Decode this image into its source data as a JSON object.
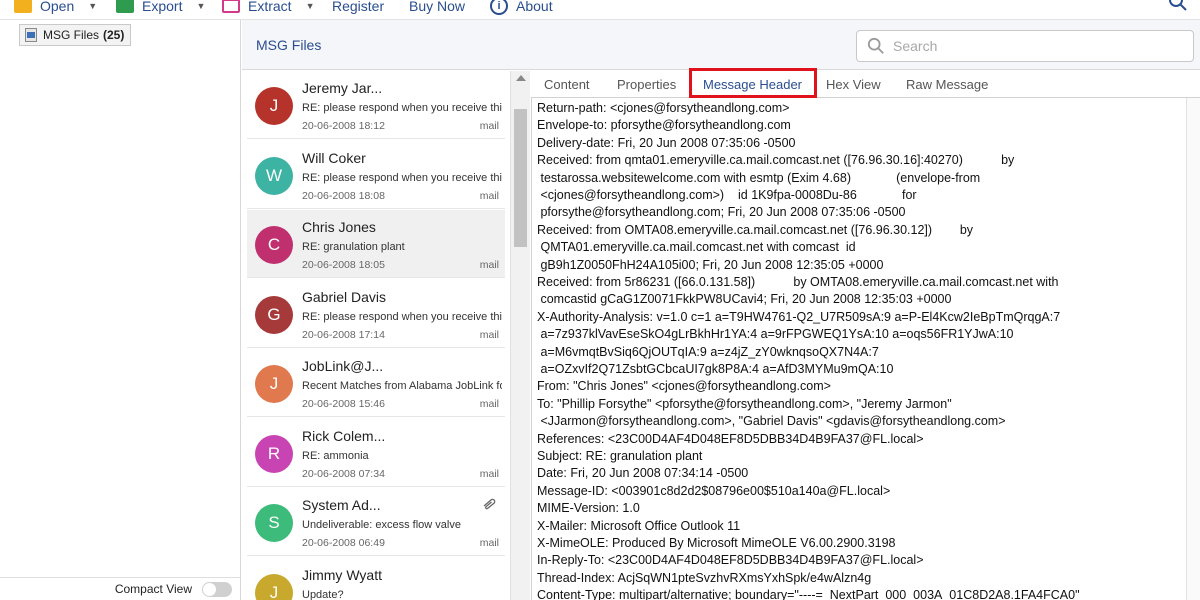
{
  "menu": {
    "open_label": "Open",
    "export_label": "Export",
    "extract_label": "Extract",
    "register_label": "Register",
    "buy_label": "Buy Now",
    "about_label": "About"
  },
  "folder_tree": {
    "node_label": "MSG Files",
    "node_count": "(25)"
  },
  "compact_view_label": "Compact View",
  "main": {
    "title": "MSG Files",
    "search_placeholder": "Search"
  },
  "messages": [
    {
      "initial": "J",
      "color": "#b5332a",
      "name": "Jeremy Jar...",
      "subject": "RE: please respond when you receive this",
      "date": "20-06-2008 18:12",
      "type": "mail"
    },
    {
      "initial": "W",
      "color": "#3db3a3",
      "name": "Will Coker",
      "subject": "RE: please respond when you receive this",
      "date": "20-06-2008 18:08",
      "type": "mail"
    },
    {
      "initial": "C",
      "color": "#c0306e",
      "name": "Chris Jones",
      "subject": "RE: granulation plant",
      "date": "20-06-2008 18:05",
      "type": "mail"
    },
    {
      "initial": "G",
      "color": "#a63a3a",
      "name": "Gabriel Davis",
      "subject": "RE: please respond when you receive this",
      "date": "20-06-2008 17:14",
      "type": "mail"
    },
    {
      "initial": "J",
      "color": "#e07a4e",
      "name": "JobLink@J...",
      "subject": "Recent Matches from Alabama JobLink for",
      "date": "20-06-2008 15:46",
      "type": "mail"
    },
    {
      "initial": "R",
      "color": "#c844b3",
      "name": "Rick Colem...",
      "subject": "RE: ammonia",
      "date": "20-06-2008 07:34",
      "type": "mail"
    },
    {
      "initial": "S",
      "color": "#3cbb7a",
      "name": "System Ad...",
      "subject": "Undeliverable: excess flow valve",
      "date": "20-06-2008 06:49",
      "type": "mail"
    },
    {
      "initial": "J",
      "color": "#c8a92e",
      "name": "Jimmy Wyatt",
      "subject": "Update?",
      "date": "",
      "type": ""
    }
  ],
  "tabs": {
    "content": "Content",
    "properties": "Properties",
    "message_header": "Message Header",
    "hex_view": "Hex View",
    "raw_message": "Raw Message"
  },
  "header_lines": [
    "Return-path: <cjones@forsytheandlong.com>",
    "Envelope-to: pforsythe@forsytheandlong.com",
    "Delivery-date: Fri, 20 Jun 2008 07:35:06 -0500",
    "Received: from qmta01.emeryville.ca.mail.comcast.net ([76.96.30.16]:40270)           by",
    " testarossa.websitewelcome.com with esmtp (Exim 4.68)             (envelope-from",
    " <cjones@forsytheandlong.com>)    id 1K9fpa-0008Du-86             for",
    " pforsythe@forsytheandlong.com; Fri, 20 Jun 2008 07:35:06 -0500",
    "Received: from OMTA08.emeryville.ca.mail.comcast.net ([76.96.30.12])        by",
    " QMTA01.emeryville.ca.mail.comcast.net with comcast  id",
    " gB9h1Z0050FhH24A105i00; Fri, 20 Jun 2008 12:35:05 +0000",
    "Received: from 5r86231 ([66.0.131.58])           by OMTA08.emeryville.ca.mail.comcast.net with",
    " comcastid gCaG1Z0071FkkPW8UCavi4; Fri, 20 Jun 2008 12:35:03 +0000",
    "X-Authority-Analysis: v=1.0 c=1 a=T9HW4761-Q2_U7R509sA:9 a=P-El4Kcw2IeBpTmQrqgA:7",
    " a=7z937klVavEseSkO4gLrBkhHr1YA:4 a=9rFPGWEQ1YsA:10 a=oqs56FR1YJwA:10",
    " a=M6vmqtBvSiq6QjOUTqIA:9 a=z4jZ_zY0wknqsoQX7N4A:7",
    " a=OZxvIf2Q71ZsbtGCbcaUI7gk8P8A:4 a=AfD3MYMu9mQA:10",
    "From: \"Chris Jones\" <cjones@forsytheandlong.com>",
    "To: \"Phillip Forsythe\" <pforsythe@forsytheandlong.com>, \"Jeremy Jarmon\"",
    " <JJarmon@forsytheandlong.com>, \"Gabriel Davis\" <gdavis@forsytheandlong.com>",
    "References: <23C00D4AF4D048EF8D5DBB34D4B9FA37@FL.local>",
    "Subject: RE: granulation plant",
    "Date: Fri, 20 Jun 2008 07:34:14 -0500",
    "Message-ID: <003901c8d2d2$08796e00$510a140a@FL.local>",
    "MIME-Version: 1.0",
    "X-Mailer: Microsoft Office Outlook 11",
    "X-MimeOLE: Produced By Microsoft MimeOLE V6.00.2900.3198",
    "In-Reply-To: <23C00D4AF4D048EF8D5DBB34D4B9FA37@FL.local>",
    "Thread-Index: AcjSqWN1pteSvzhvRXmsYxhSpk/e4wAlzn4g",
    "Content-Type: multipart/alternative; boundary=\"----=_NextPart_000_003A_01C8D2A8.1FA4FCA0\""
  ]
}
